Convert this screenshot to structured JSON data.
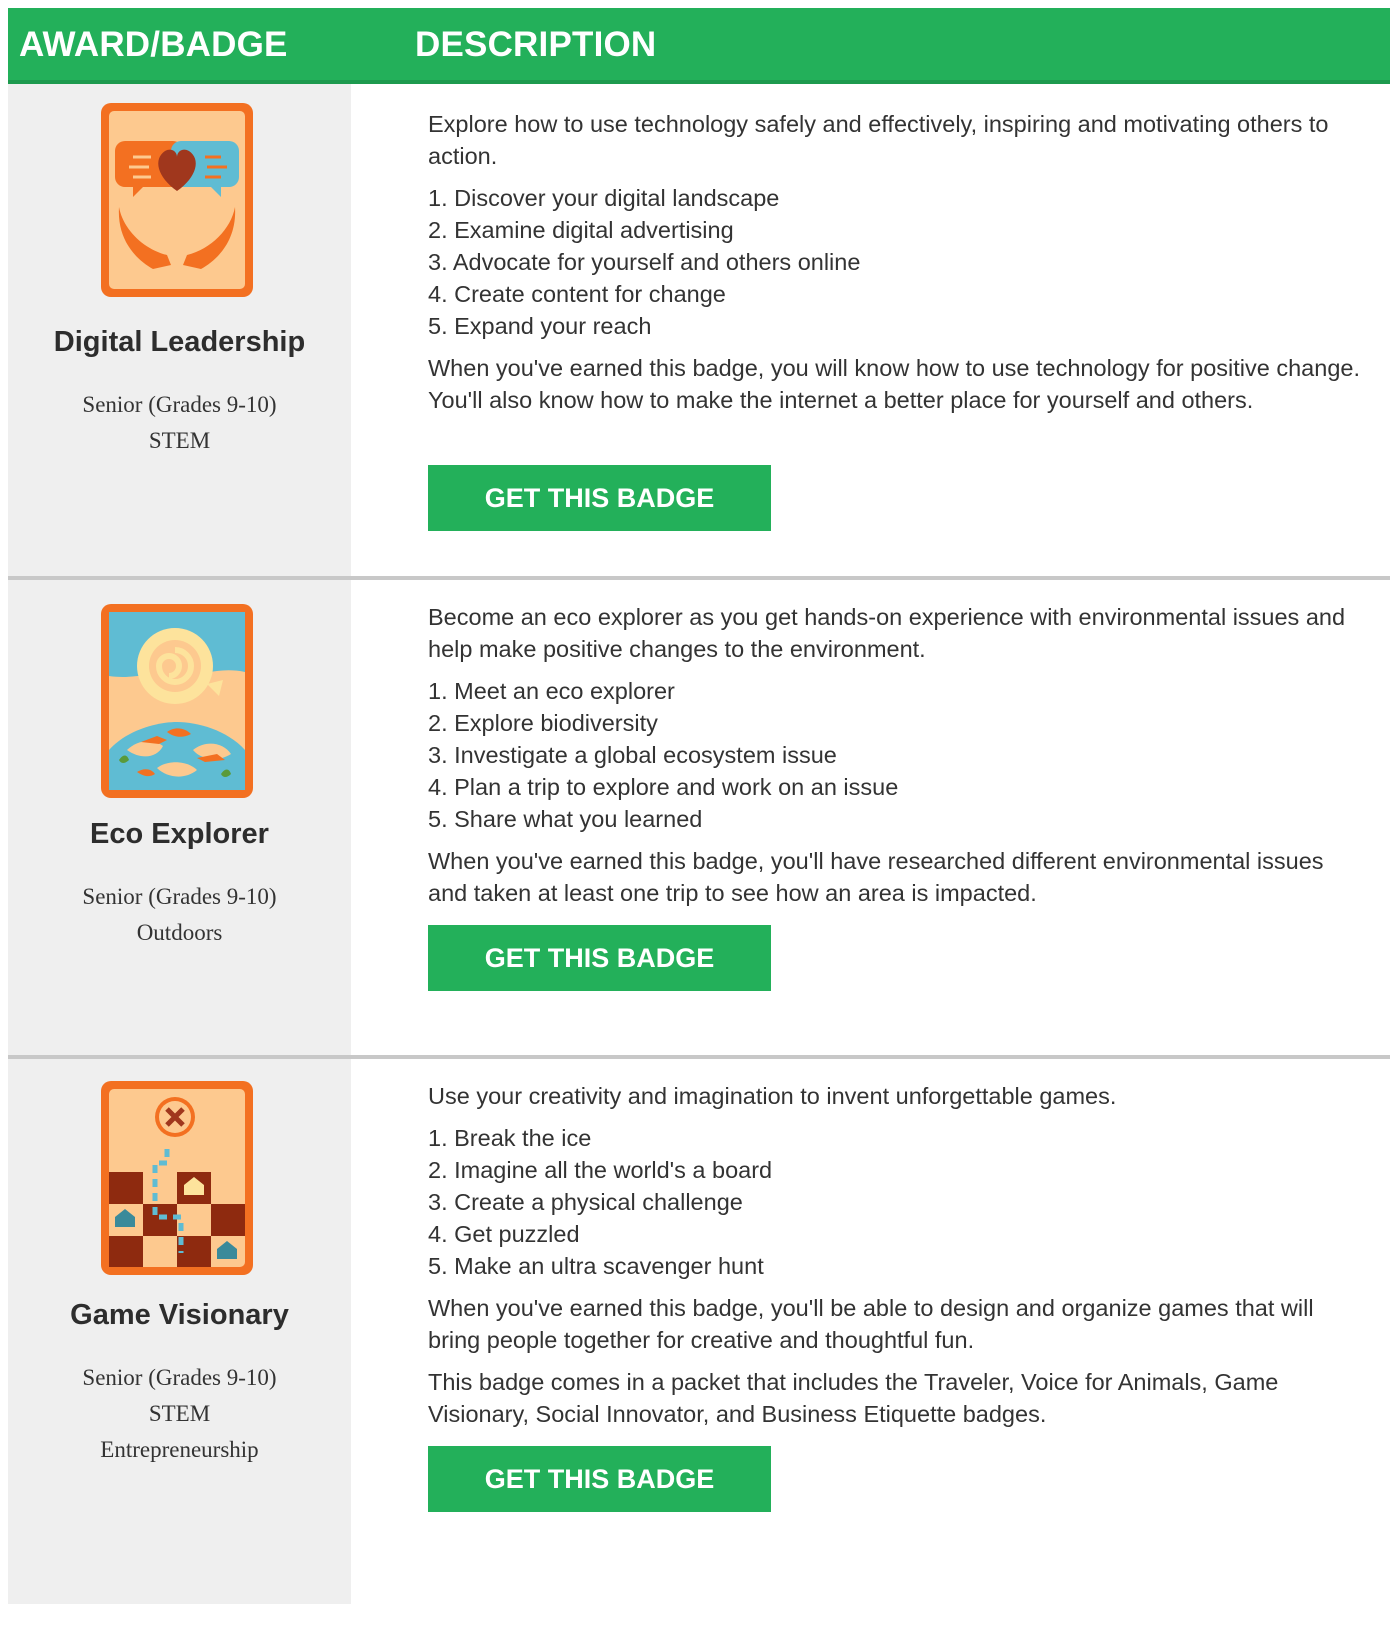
{
  "header": {
    "col1": "AWARD/BADGE",
    "col2": "DESCRIPTION"
  },
  "rows": [
    {
      "name": "Digital Leadership",
      "level": "Senior (Grades 9-10)",
      "categories": [
        "STEM"
      ],
      "intro": "Explore how to use technology safely and effectively, inspiring and motivating others to action.",
      "steps": [
        "1. Discover your digital landscape",
        "2. Examine digital advertising",
        "3. Advocate for yourself and others online",
        "4. Create content for change",
        "5. Expand your reach"
      ],
      "outcome": "When you've earned this badge, you will know how to use technology for positive change.",
      "outcome2": "You'll also know how to make the internet a better place for yourself and others.",
      "button": "GET THIS BADGE",
      "icon": "digital-leadership-badge-icon"
    },
    {
      "name": "Eco Explorer",
      "level": "Senior (Grades 9-10)",
      "categories": [
        "Outdoors"
      ],
      "intro": "Become an eco explorer as you get hands-on experience with environmental issues and help make positive changes to the environment.",
      "steps": [
        "1. Meet an eco explorer",
        "2. Explore biodiversity",
        "3. Investigate a global ecosystem issue",
        "4. Plan a trip to explore and work on an issue",
        "5. Share what you learned"
      ],
      "outcome": "When you've earned this badge, you'll have researched different environmental issues and taken at least one trip to see how an area is impacted.",
      "button": "GET THIS BADGE",
      "icon": "eco-explorer-badge-icon"
    },
    {
      "name": "Game Visionary",
      "level": "Senior (Grades 9-10)",
      "categories": [
        "STEM",
        "Entrepreneurship"
      ],
      "intro": "Use your creativity and imagination to invent unforgettable games.",
      "steps": [
        "1. Break the ice",
        "2. Imagine all the world's a board",
        "3. Create a physical challenge",
        "4. Get puzzled",
        "5. Make an ultra scavenger hunt"
      ],
      "outcome": "When you've earned this badge, you'll be able to design and organize games that will bring people together for creative and thoughtful fun.",
      "note": "This badge comes in a packet that includes the Traveler, Voice for Animals, Game Visionary, Social Innovator, and Business Etiquette badges.",
      "button": "GET THIS BADGE",
      "icon": "game-visionary-badge-icon"
    }
  ],
  "colors": {
    "green": "#23b05a",
    "badge_border": "#f37021",
    "left_column_bg": "#efefef"
  }
}
